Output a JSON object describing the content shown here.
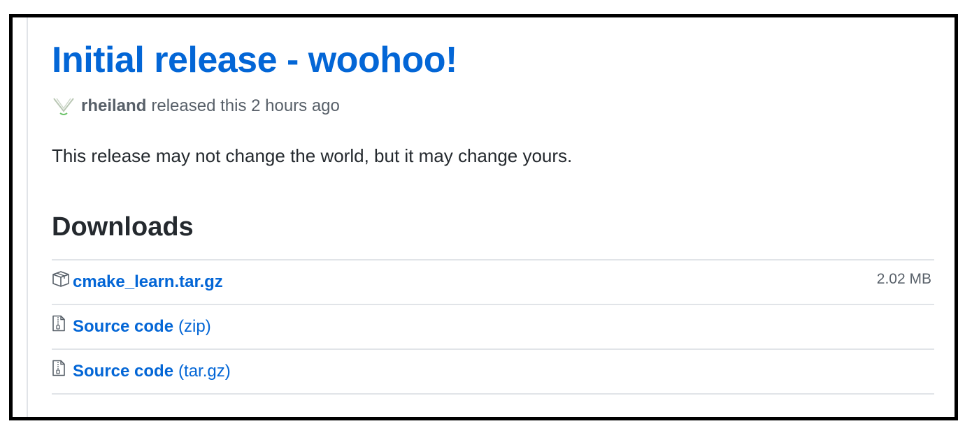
{
  "release": {
    "title": "Initial release - woohoo!",
    "author": "rheiland",
    "meta_text": "released this 2 hours ago",
    "description": "This release may not change the world, but it may change yours."
  },
  "downloads": {
    "heading": "Downloads",
    "assets": [
      {
        "name": "cmake_learn.tar.gz",
        "suffix": "",
        "size": "2.02 MB",
        "icon": "package-icon"
      },
      {
        "name": "Source code",
        "suffix": "(zip)",
        "size": "",
        "icon": "file-zip-icon"
      },
      {
        "name": "Source code",
        "suffix": "(tar.gz)",
        "size": "",
        "icon": "file-zip-icon"
      }
    ]
  },
  "colors": {
    "link": "#0366d6",
    "text": "#24292e",
    "muted": "#586069",
    "border": "#e1e4e8"
  }
}
